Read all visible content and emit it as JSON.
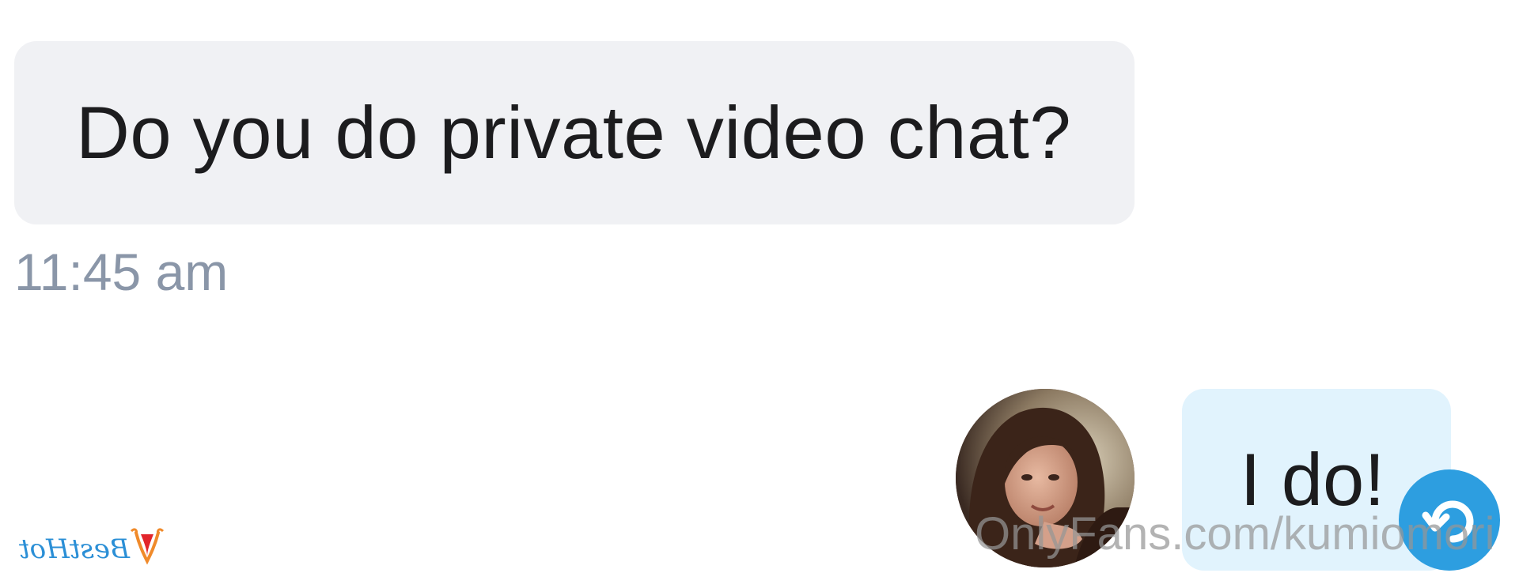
{
  "conversation": {
    "messages": [
      {
        "direction": "incoming",
        "text": "Do you do private video chat?"
      },
      {
        "direction": "outgoing",
        "text": "I do!"
      }
    ],
    "incoming_time": "11:45 am"
  },
  "watermark": {
    "text": "OnlyFans.com/kumiomori"
  },
  "logo": {
    "text": "BestHot"
  },
  "colors": {
    "incoming_bubble": "#f0f1f4",
    "outgoing_bubble": "#e1f3fd",
    "timestamp": "#8a96a8",
    "accent": "#2d9ee0"
  },
  "icons": {
    "reply": "reply-arrow-icon",
    "avatar": "user-avatar"
  }
}
